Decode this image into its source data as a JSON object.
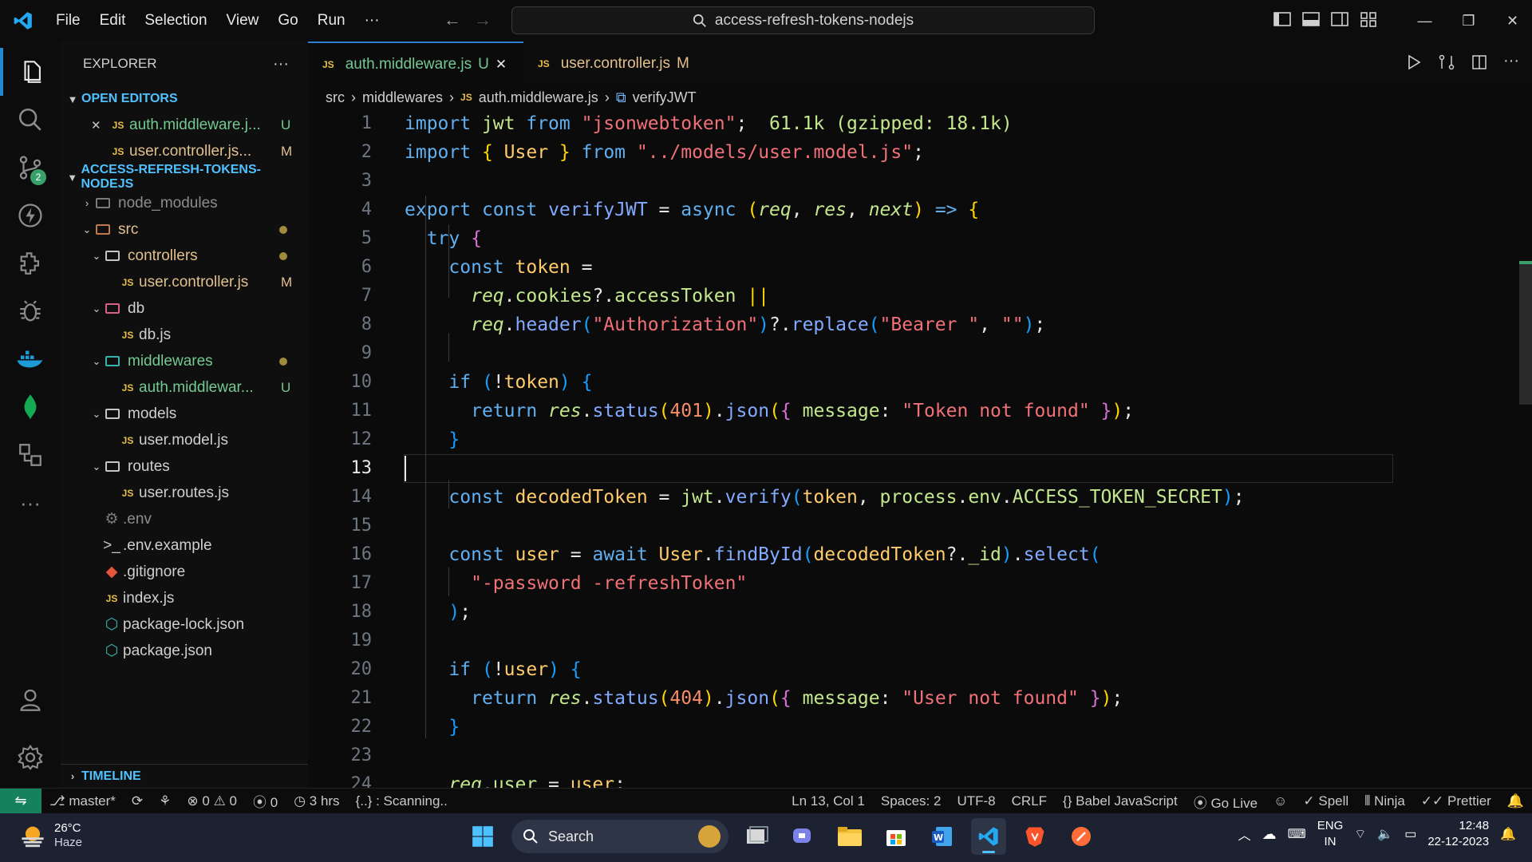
{
  "menu": [
    "File",
    "Edit",
    "Selection",
    "View",
    "Go",
    "Run",
    "···"
  ],
  "command_center": {
    "text": "access-refresh-tokens-nodejs"
  },
  "activity_bar": {
    "source_control_badge": "2"
  },
  "explorer": {
    "title": "EXPLORER",
    "more": "···",
    "open_editors_label": "OPEN EDITORS",
    "open_editors": [
      {
        "name": "auth.middleware.j...",
        "status": "U",
        "close": "✕"
      },
      {
        "name": "user.controller.js...",
        "status": "M"
      }
    ],
    "project_label": "ACCESS-REFRESH-TOKENS-NODEJS",
    "tree": {
      "node_modules": "node_modules",
      "src": "src",
      "controllers": "controllers",
      "user_controller": "user.controller.js",
      "user_controller_status": "M",
      "db": "db",
      "db_js": "db.js",
      "middlewares": "middlewares",
      "auth_middleware": "auth.middlewar...",
      "auth_middleware_status": "U",
      "models": "models",
      "user_model": "user.model.js",
      "routes": "routes",
      "user_routes": "user.routes.js",
      "env": ".env",
      "env_example": ".env.example",
      "gitignore": ".gitignore",
      "index": "index.js",
      "package_lock": "package-lock.json",
      "package": "package.json"
    },
    "timeline_label": "TIMELINE"
  },
  "tabs": [
    {
      "label": "auth.middleware.js",
      "status": "U",
      "close": "✕"
    },
    {
      "label": "user.controller.js",
      "status": "M"
    }
  ],
  "breadcrumbs": {
    "src": "src",
    "middlewares": "middlewares",
    "file": "auth.middleware.js",
    "symbol": "verifyJWT"
  },
  "editor": {
    "line_numbers": [
      "1",
      "2",
      "3",
      "4",
      "5",
      "6",
      "7",
      "8",
      "9",
      "10",
      "11",
      "12",
      "13",
      "14",
      "15",
      "16",
      "17",
      "18",
      "19",
      "20",
      "21",
      "22",
      "23",
      "24"
    ],
    "current_line": "13",
    "import_size_hint": "61.1k (gzipped: 18.1k)"
  },
  "status_bar": {
    "branch": "master*",
    "problems_errors": "0",
    "problems_warnings": "0",
    "ports": "0",
    "time": "3 hrs",
    "scanning": "{..} : Scanning..",
    "position": "Ln 13, Col 1",
    "spaces": "Spaces: 2",
    "encoding": "UTF-8",
    "eol": "CRLF",
    "language": "Babel JavaScript",
    "go_live": "Go Live",
    "spell": "Spell",
    "ninja": "Ninja",
    "prettier": "Prettier"
  },
  "taskbar": {
    "temperature": "26°C",
    "weather": "Haze",
    "search": "Search",
    "lang1": "ENG",
    "lang2": "IN",
    "time": "12:48",
    "date": "22-12-2023"
  },
  "colors": {
    "accent": "#2f7fd3",
    "git_untracked": "#73c991",
    "git_modified": "#e2c08d",
    "remote": "#16825d"
  }
}
